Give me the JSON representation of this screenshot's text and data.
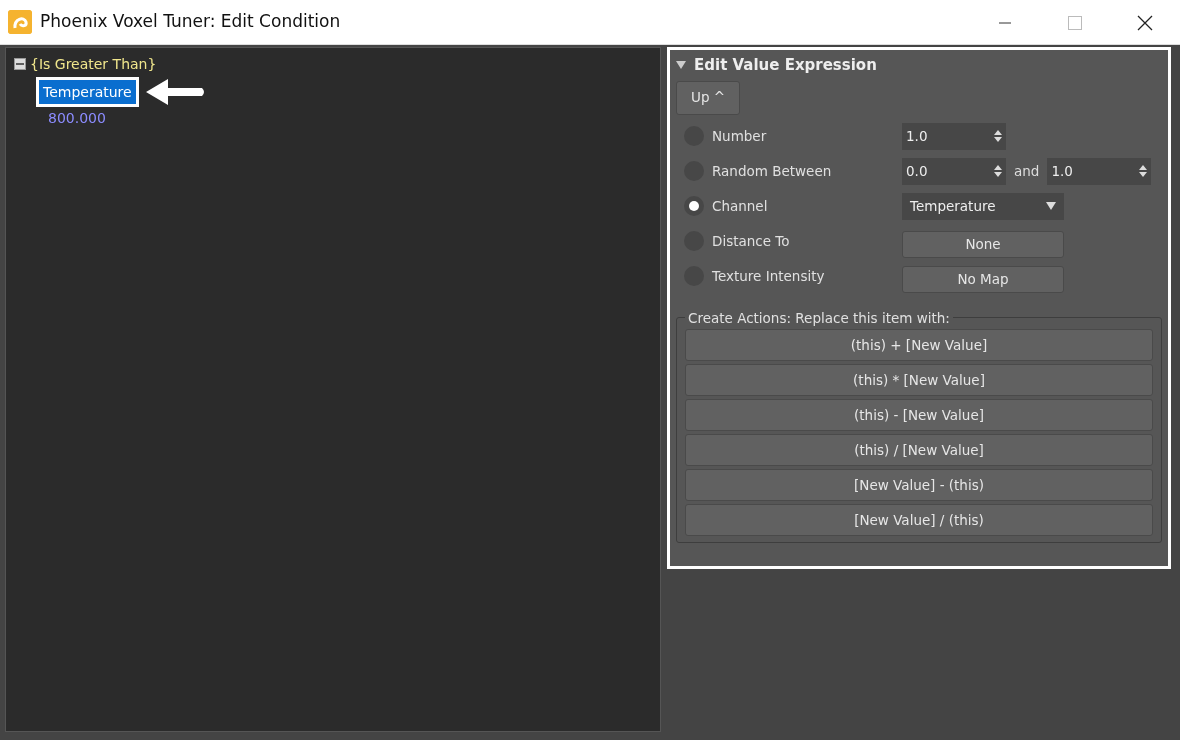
{
  "window": {
    "title": "Phoenix Voxel Tuner: Edit Condition"
  },
  "tree": {
    "label": "{Is Greater Than}",
    "expanded": true,
    "color": "#f0e68c",
    "children": [
      {
        "label": "Temperature",
        "selected": true
      },
      {
        "label": "800.000",
        "selected": false
      }
    ]
  },
  "panel": {
    "title": "Edit Value Expression",
    "expanded": true,
    "up_button": "Up ^",
    "options": [
      {
        "label": "Number",
        "selected": false,
        "kind": "spinner",
        "value": "1.0"
      },
      {
        "label": "Random Between",
        "selected": false,
        "kind": "range",
        "value": "0.0",
        "joiner": "and",
        "value2": "1.0"
      },
      {
        "label": "Channel",
        "selected": true,
        "kind": "dropdown",
        "value": "Temperature"
      },
      {
        "label": "Distance To",
        "selected": false,
        "kind": "button",
        "value": "None"
      },
      {
        "label": "Texture Intensity",
        "selected": false,
        "kind": "button",
        "value": "No Map"
      }
    ],
    "actions": {
      "legend": "Create Actions: Replace this item with:",
      "buttons": [
        "(this) + [New Value]",
        "(this) * [New Value]",
        "(this) - [New Value]",
        "(this) / [New Value]",
        "[New Value] - (this)",
        "[New Value] / (this)"
      ]
    }
  }
}
